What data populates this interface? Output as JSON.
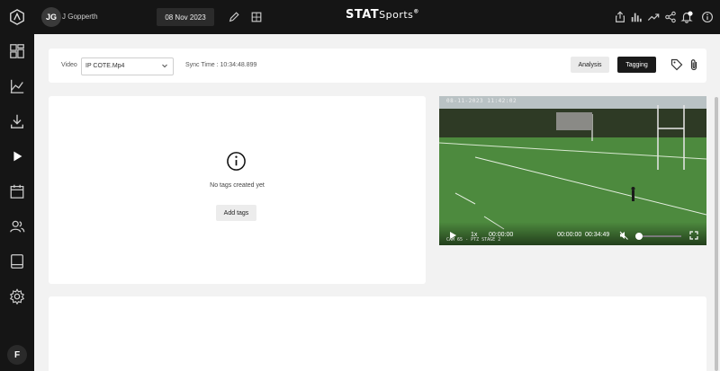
{
  "topbar": {
    "user_initials": "JG",
    "user_name": "J Gopperth",
    "date": "08 Nov 2023",
    "brand": "STATSports",
    "brand_bold": "STAT",
    "brand_lite": "Sports",
    "brand_mark": "®",
    "accent": "#ffffff"
  },
  "sidebar": {
    "items": [
      {
        "icon": "app-logo-icon"
      },
      {
        "icon": "dashboard-icon"
      },
      {
        "icon": "analytics-icon"
      },
      {
        "icon": "download-icon"
      },
      {
        "icon": "play-icon",
        "active": true
      },
      {
        "icon": "calendar-icon"
      },
      {
        "icon": "users-icon"
      },
      {
        "icon": "tablet-icon"
      },
      {
        "icon": "settings-icon"
      }
    ],
    "user_initial": "F"
  },
  "controls": {
    "video_label": "Video",
    "video_value": "IP COTE.Mp4",
    "sync_time": "Sync Time : 10:34:48.899",
    "analysis_label": "Analysis",
    "tagging_label": "Tagging"
  },
  "tags": {
    "empty_text": "No tags created yet",
    "add_label": "Add tags"
  },
  "video": {
    "timestamp": "08-11-2023 11:42:02",
    "camera_label": "CAM 65 - PTZ STAGE 2",
    "speed": "1x",
    "elapsed": "00:00:00",
    "current": "00:00:00",
    "duration": "00:34:49",
    "volume_level": 0.0
  },
  "colors": {
    "dark": "#151515",
    "surface": "#ffffff",
    "background": "#f2f2f2",
    "button_dark": "#1a1a1a"
  }
}
